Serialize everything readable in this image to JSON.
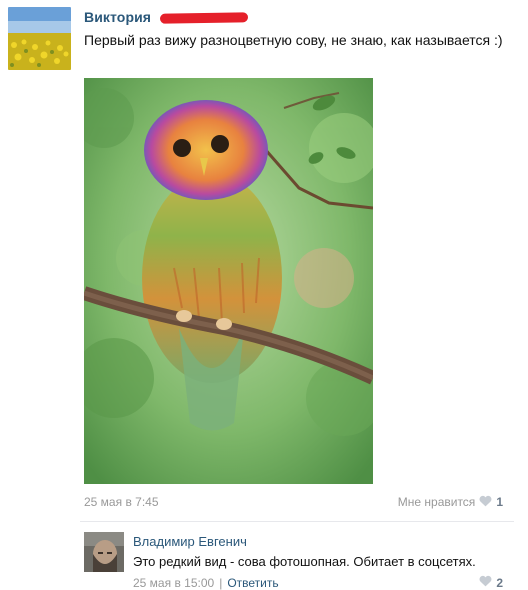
{
  "post": {
    "author": "Виктория",
    "text": "Первый раз вижу разноцветную сову, не знаю, как называется :)",
    "date": "25 мая в 7:45",
    "like_label": "Мне нравится",
    "like_count": "1",
    "like_icon": "heart-icon"
  },
  "comment": {
    "author": "Владимир Евгенич",
    "text": "Это редкий вид - сова фотошопная. Обитает в соцсетях.",
    "date": "25 мая в 15:00",
    "separator": "|",
    "reply_label": "Ответить",
    "like_count": "2",
    "like_icon": "heart-icon"
  },
  "colors": {
    "link": "#2b587a",
    "muted": "#999999",
    "redaction": "#e5202a"
  }
}
